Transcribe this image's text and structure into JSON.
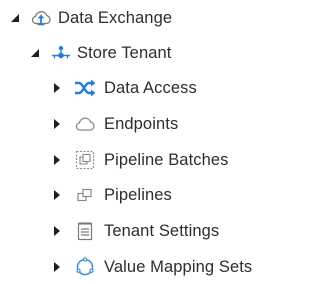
{
  "tree": {
    "root": {
      "label": "Data Exchange",
      "icon": "cloud-sync-icon",
      "expanded": true
    },
    "tenant": {
      "label": "Store Tenant",
      "icon": "tenant-node-icon",
      "expanded": true
    },
    "children": [
      {
        "label": "Data Access",
        "icon": "shuffle-icon",
        "expanded": false
      },
      {
        "label": "Endpoints",
        "icon": "cloud-outline-icon",
        "expanded": false
      },
      {
        "label": "Pipeline Batches",
        "icon": "batch-icon",
        "expanded": false
      },
      {
        "label": "Pipelines",
        "icon": "pipelines-icon",
        "expanded": false
      },
      {
        "label": "Tenant Settings",
        "icon": "notepad-icon",
        "expanded": false
      },
      {
        "label": "Value Mapping Sets",
        "icon": "circle-dots-icon",
        "expanded": false
      }
    ]
  },
  "colors": {
    "text": "#2d2d2d",
    "accent_blue": "#2a7fd4",
    "icon_gray": "#8a8a8a",
    "toggle": "#1f1f1f"
  }
}
